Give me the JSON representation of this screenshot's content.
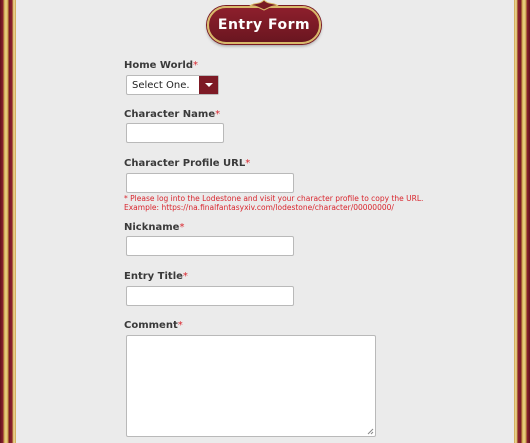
{
  "form": {
    "title": "Entry Form",
    "required_mark": "*",
    "home_world": {
      "label": "Home World",
      "selected": "Select One."
    },
    "character_name": {
      "label": "Character Name",
      "value": ""
    },
    "profile_url": {
      "label": "Character Profile URL",
      "value": "",
      "hint_line1": "* Please log into the Lodestone and visit your character profile to copy the URL.",
      "hint_line2": "Example: https://na.finalfantasyxiv.com/lodestone/character/00000000/"
    },
    "nickname": {
      "label": "Nickname",
      "value": ""
    },
    "entry_title": {
      "label": "Entry Title",
      "value": ""
    },
    "comment": {
      "label": "Comment",
      "value": ""
    }
  },
  "colors": {
    "accent": "#7d1a25",
    "required": "#d9262e",
    "gold_border": "#d9b96a",
    "panel_bg": "#ebebeb"
  },
  "icons": [
    "ornament-icon",
    "chevron-down-icon",
    "resize-handle-icon"
  ]
}
